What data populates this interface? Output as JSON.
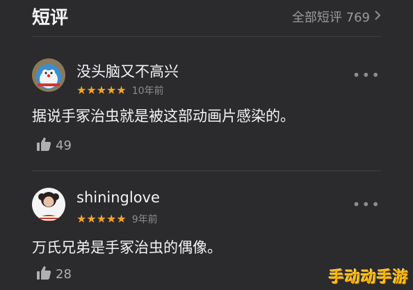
{
  "header": {
    "title": "短评",
    "all_label": "全部短评 769",
    "chevron_icon": "chevron-right-icon"
  },
  "reviews": [
    {
      "username": "没头脑又不高兴",
      "stars": "★★★★★",
      "rating": 5,
      "time": "10年前",
      "content": "据说手冢治虫就是被这部动画片感染的。",
      "likes": "49",
      "more": "•••"
    },
    {
      "username": "shininglove",
      "stars": "★★★★★",
      "rating": 5,
      "time": "9年前",
      "content": "万氏兄弟是手冢治虫的偶像。",
      "likes": "28",
      "more": "•••"
    }
  ],
  "watermark": "手动动手游",
  "colors": {
    "background": "#2b2a2c",
    "star": "#f5a623",
    "watermark": "#f7b500"
  }
}
